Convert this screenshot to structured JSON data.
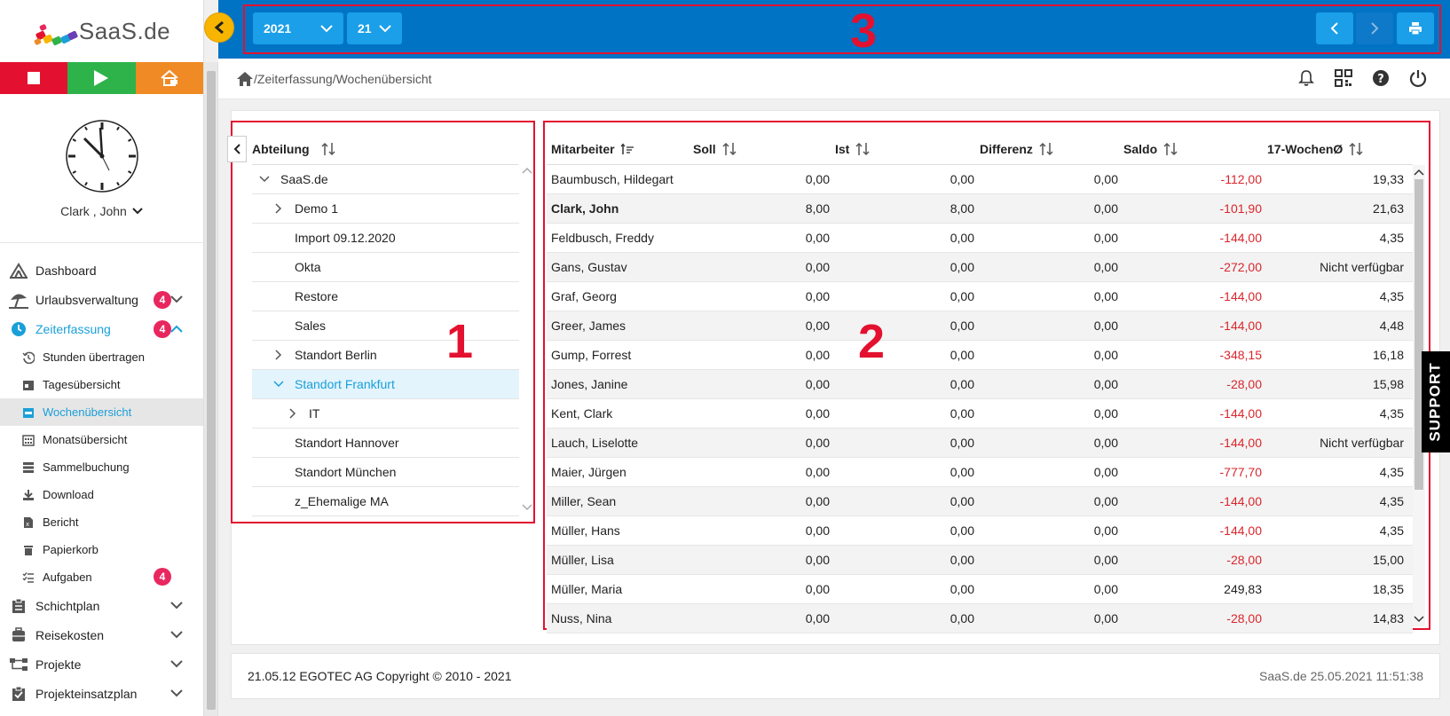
{
  "logo": {
    "text": "SaaS.de"
  },
  "sidebar": {
    "user_name": "Clark , John",
    "menu": [
      {
        "label": "Dashboard"
      },
      {
        "label": "Urlaubsverwaltung",
        "badge": "4"
      },
      {
        "label": "Zeiterfassung",
        "badge": "4"
      }
    ],
    "sub": [
      {
        "label": "Stunden übertragen"
      },
      {
        "label": "Tagesübersicht"
      },
      {
        "label": "Wochenübersicht"
      },
      {
        "label": "Monatsübersicht"
      },
      {
        "label": "Sammelbuchung"
      },
      {
        "label": "Download"
      },
      {
        "label": "Bericht"
      },
      {
        "label": "Papierkorb"
      },
      {
        "label": "Aufgaben",
        "badge": "4"
      }
    ],
    "menu2": [
      {
        "label": "Schichtplan"
      },
      {
        "label": "Reisekosten"
      },
      {
        "label": "Projekte"
      },
      {
        "label": "Projekteinsatzplan"
      }
    ]
  },
  "topbar": {
    "year": "2021",
    "week": "21",
    "annotation": "3"
  },
  "breadcrumb": {
    "path": "/Zeiterfassung/Wochenübersicht"
  },
  "tree": {
    "header": "Abteilung",
    "annotation": "1",
    "items": [
      "SaaS.de",
      "Demo 1",
      "Import 09.12.2020",
      "Okta",
      "Restore",
      "Sales",
      "Standort Berlin",
      "Standort Frankfurt",
      "IT",
      "Standort Hannover",
      "Standort München",
      "z_Ehemalige MA"
    ]
  },
  "table": {
    "annotation": "2",
    "headers": [
      "Mitarbeiter",
      "Soll",
      "Ist",
      "Differenz",
      "Saldo",
      "17-WochenØ"
    ],
    "rows": [
      [
        "Baumbusch, Hildegart",
        "0,00",
        "0,00",
        "0,00",
        "-112,00",
        "19,33"
      ],
      [
        "Clark, John",
        "8,00",
        "8,00",
        "0,00",
        "-101,90",
        "21,63"
      ],
      [
        "Feldbusch, Freddy",
        "0,00",
        "0,00",
        "0,00",
        "-144,00",
        "4,35"
      ],
      [
        "Gans, Gustav",
        "0,00",
        "0,00",
        "0,00",
        "-272,00",
        "Nicht verfügbar"
      ],
      [
        "Graf, Georg",
        "0,00",
        "0,00",
        "0,00",
        "-144,00",
        "4,35"
      ],
      [
        "Greer, James",
        "0,00",
        "0,00",
        "0,00",
        "-144,00",
        "4,48"
      ],
      [
        "Gump, Forrest",
        "0,00",
        "0,00",
        "0,00",
        "-348,15",
        "16,18"
      ],
      [
        "Jones, Janine",
        "0,00",
        "0,00",
        "0,00",
        "-28,00",
        "15,98"
      ],
      [
        "Kent, Clark",
        "0,00",
        "0,00",
        "0,00",
        "-144,00",
        "4,35"
      ],
      [
        "Lauch, Liselotte",
        "0,00",
        "0,00",
        "0,00",
        "-144,00",
        "Nicht verfügbar"
      ],
      [
        "Maier, Jürgen",
        "0,00",
        "0,00",
        "0,00",
        "-777,70",
        "4,35"
      ],
      [
        "Miller, Sean",
        "0,00",
        "0,00",
        "0,00",
        "-144,00",
        "4,35"
      ],
      [
        "Müller, Hans",
        "0,00",
        "0,00",
        "0,00",
        "-144,00",
        "4,35"
      ],
      [
        "Müller, Lisa",
        "0,00",
        "0,00",
        "0,00",
        "-28,00",
        "15,00"
      ],
      [
        "Müller, Maria",
        "0,00",
        "0,00",
        "0,00",
        "249,83",
        "18,35"
      ],
      [
        "Nuss, Nina",
        "0,00",
        "0,00",
        "0,00",
        "-28,00",
        "14,83"
      ]
    ]
  },
  "support": "SUPPORT",
  "footer": {
    "left": "21.05.12 EGOTEC AG Copyright © 2010 - 2021",
    "right": "SaaS.de  25.05.2021 11:51:38"
  },
  "colors": {
    "accent": "#1a9fd9",
    "topbar": "#0073c5",
    "negative": "#d9262c",
    "annotation": "#e3112f"
  }
}
